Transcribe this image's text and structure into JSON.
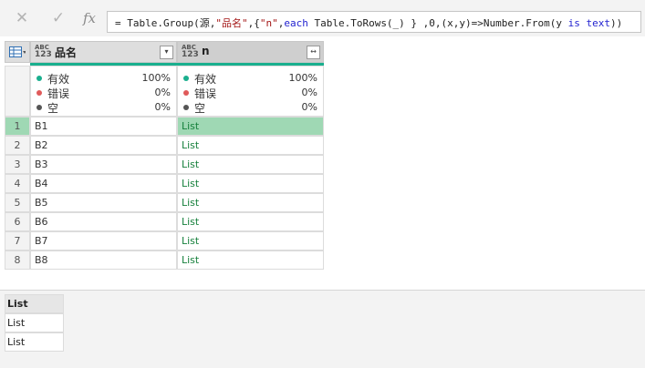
{
  "formula_bar": {
    "cancel_icon": "✕",
    "confirm_icon": "✓",
    "fx_label": "fx",
    "formula_parts": [
      {
        "t": "= Table.Group(源,",
        "c": ""
      },
      {
        "t": "\"品名\"",
        "c": "st"
      },
      {
        "t": ",{",
        "c": ""
      },
      {
        "t": "\"n\"",
        "c": "st"
      },
      {
        "t": ",",
        "c": ""
      },
      {
        "t": "each",
        "c": "kw"
      },
      {
        "t": " Table.ToRows(_) } ,0,(x,y)=>Number.From(y ",
        "c": ""
      },
      {
        "t": "is",
        "c": "kw"
      },
      {
        "t": " ",
        "c": ""
      },
      {
        "t": "text",
        "c": "kw"
      },
      {
        "t": "))",
        "c": ""
      }
    ]
  },
  "table": {
    "columns": [
      {
        "type_top": "ABC",
        "type_bottom": "123",
        "name": "品名",
        "button": "▾"
      },
      {
        "type_top": "ABC",
        "type_bottom": "123",
        "name": "n",
        "button": "↔"
      }
    ],
    "profile": [
      {
        "label": "有效",
        "percents": [
          "100%",
          "100%"
        ],
        "color": "#1aaf8e"
      },
      {
        "label": "错误",
        "percents": [
          "0%",
          "0%"
        ],
        "color": "#e05a5a"
      },
      {
        "label": "空",
        "percents": [
          "0%",
          "0%"
        ],
        "color": "#555555"
      }
    ],
    "rows": [
      {
        "num": "1",
        "name": "B1",
        "n": "List"
      },
      {
        "num": "2",
        "name": "B2",
        "n": "List"
      },
      {
        "num": "3",
        "name": "B3",
        "n": "List"
      },
      {
        "num": "4",
        "name": "B4",
        "n": "List"
      },
      {
        "num": "5",
        "name": "B5",
        "n": "List"
      },
      {
        "num": "6",
        "name": "B6",
        "n": "List"
      },
      {
        "num": "7",
        "name": "B7",
        "n": "List"
      },
      {
        "num": "8",
        "name": "B8",
        "n": "List"
      }
    ]
  },
  "preview": {
    "header": "List",
    "items": [
      "List",
      "List"
    ]
  }
}
